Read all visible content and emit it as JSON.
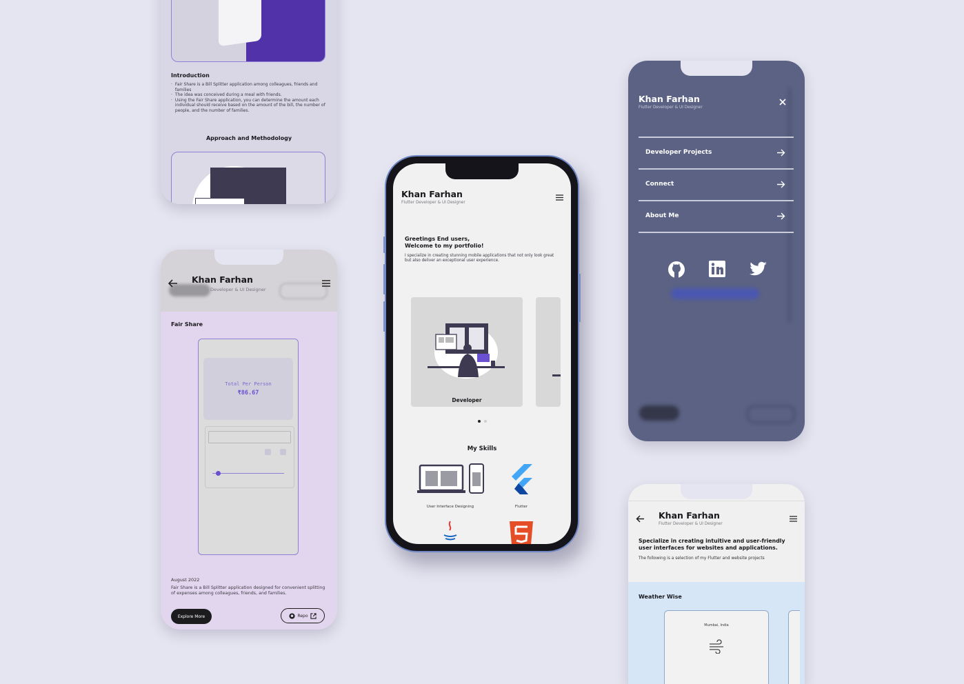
{
  "brand": {
    "name": "Khan Farhan",
    "subtitle": "Flutter Developer & UI Designer"
  },
  "colors": {
    "accent": "#6a4fd0",
    "menu_overlay": "#5b6284",
    "lavender": "#e2d6ee",
    "page_bg": "#e5e5f1"
  },
  "detail_top": {
    "intro_heading": "Introduction",
    "bullets": [
      "Fair Share is a Bill Splitter application among colleagues, friends and families",
      "The idea was conceived during a meal with friends.",
      "Using the Fair Share application, you can determine the amount each individual should receive based on the amount of the bill, the number of people, and the number of families."
    ],
    "approach_heading": "Approach and Methodology"
  },
  "project_screen": {
    "header_title": "Khan Farhan",
    "header_sub": "Developer & UI Designer",
    "project_name": "Fair Share",
    "mock": {
      "total_label": "Total Per Person",
      "total_value": "₹86.67"
    },
    "date": "August 2022",
    "description": "Fair Share is a Bill Splitter application designed for convenient splitting of expenses among colleagues, friends, and families.",
    "explore_label": "Explore More",
    "repo_label": "Repo"
  },
  "home": {
    "title": "Khan Farhan",
    "subtitle": "Flutter Developer & UI Designer",
    "greeting_line1": "Greetings End users,",
    "greeting_line2": "Welcome to my portfolio!",
    "intro": "I specialize in creating stunning mobile applications that not only look great but also deliver an exceptional user experience.",
    "carousel_label": "Developer",
    "skills_heading": "My Skills",
    "skills": [
      {
        "label": "User Interface Designing",
        "icon": "ui-design-icon"
      },
      {
        "label": "Flutter",
        "icon": "flutter-icon"
      },
      {
        "label": "",
        "icon": "java-icon"
      },
      {
        "label": "",
        "icon": "html5-icon"
      }
    ]
  },
  "menu": {
    "title": "Khan Farhan",
    "subtitle": "Flutter Developer & UI Designer",
    "items": [
      {
        "label": "Developer Projects"
      },
      {
        "label": "Connect"
      },
      {
        "label": "About Me"
      }
    ],
    "socials": [
      "github-icon",
      "linkedin-icon",
      "twitter-icon"
    ]
  },
  "projects_list": {
    "title": "Khan Farhan",
    "subtitle": "Flutter Developer & UI Designer",
    "headline": "Specialize in creating intuitive and user-friendly user interfaces for websites and applications.",
    "note": "The following is a selection of my Flutter and website projects",
    "project_name": "Weather Wise",
    "city": "Mumbai, India"
  }
}
